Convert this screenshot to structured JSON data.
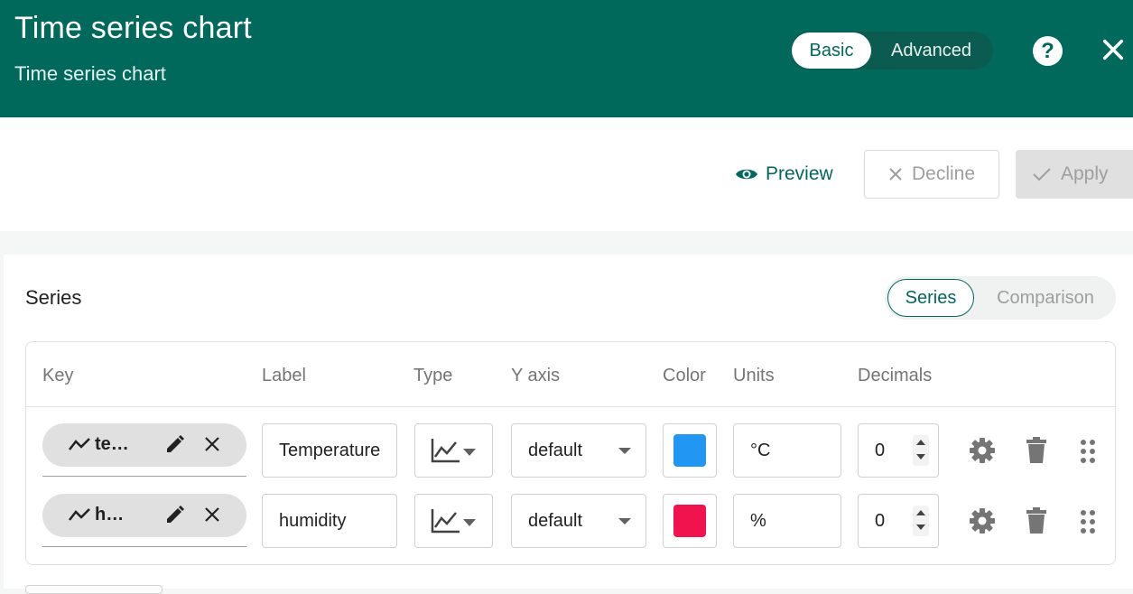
{
  "header": {
    "title": "Time series chart",
    "subtitle": "Time series chart",
    "mode_basic": "Basic",
    "mode_advanced": "Advanced",
    "help_icon": "help-circle-icon",
    "close_icon": "close-icon"
  },
  "actions": {
    "preview": "Preview",
    "decline": "Decline",
    "apply": "Apply"
  },
  "series_section": {
    "title": "Series",
    "tab_series": "Series",
    "tab_comparison": "Comparison",
    "columns": [
      "Key",
      "Label",
      "Type",
      "Y axis",
      "Color",
      "Units",
      "Decimals"
    ],
    "rows": [
      {
        "key": "temperature",
        "label": "Temperature",
        "type_icon": "line-chart-icon",
        "y_axis": "default",
        "color": "#2196f3",
        "units": "°C",
        "decimals": "0"
      },
      {
        "key": "humidity",
        "label": "humidity",
        "type_icon": "line-chart-icon",
        "y_axis": "default",
        "color": "#f0134d",
        "units": "%",
        "decimals": "0"
      }
    ]
  },
  "colors": {
    "primary": "#00695c",
    "header_bg": "#00695c"
  }
}
